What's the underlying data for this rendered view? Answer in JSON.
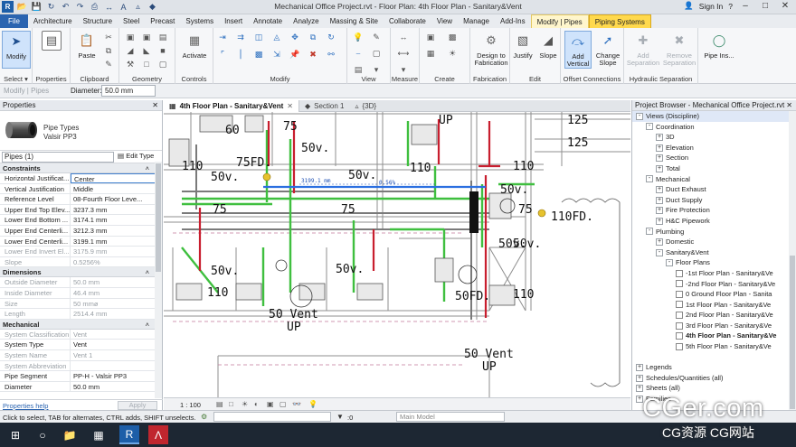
{
  "titlebar": {
    "title": "Mechanical Office Project.rvt - Floor Plan: 4th Floor Plan - Sanitary&Vent",
    "sign_in": "Sign In",
    "app_letter": "R"
  },
  "ribbon_tabs": [
    "File",
    "Architecture",
    "Structure",
    "Steel",
    "Precast",
    "Systems",
    "Insert",
    "Annotate",
    "Analyze",
    "Massing & Site",
    "Collaborate",
    "View",
    "Manage",
    "Add-Ins",
    "Modify | Pipes",
    "Piping Systems"
  ],
  "ribbon": {
    "select": {
      "modify": "Modify",
      "label": "Select ▾"
    },
    "properties": {
      "label": "Properties"
    },
    "clipboard": {
      "paste": "Paste",
      "label": "Clipboard"
    },
    "geometry": {
      "label": "Geometry"
    },
    "controls": {
      "activate": "Activate",
      "label": "Controls"
    },
    "modify": {
      "label": "Modify"
    },
    "view": {
      "label": "View"
    },
    "measure": {
      "label": "Measure"
    },
    "create": {
      "label": "Create"
    },
    "fabrication": {
      "design_to": "Design to Fabrication",
      "label": "Fabrication"
    },
    "edit": {
      "justify": "Justify",
      "slope": "Slope",
      "label": "Edit"
    },
    "offset": {
      "add_vertical": "Add Vertical",
      "change_slope": "Change Slope",
      "label": "Offset Connections"
    },
    "hydraulic": {
      "add_sep": "Add Separation",
      "remove_sep": "Remove Separation",
      "label": "Hydraulic Separation"
    },
    "pipe_ins": {
      "label": "Pipe Ins..."
    }
  },
  "optbar": {
    "context": "Modify | Pipes",
    "diameter_label": "Diameter:",
    "diameter_value": "50.0 mm"
  },
  "properties": {
    "title": "Properties",
    "type_family": "Pipe Types",
    "type_name": "Valsir PP3",
    "filter": "Pipes (1)",
    "edit_type": "Edit Type",
    "groups": [
      {
        "name": "Constraints",
        "rows": [
          {
            "k": "Horizontal Justificat...",
            "v": "Center",
            "ro": false,
            "sel": true
          },
          {
            "k": "Vertical Justification",
            "v": "Middle",
            "ro": false
          },
          {
            "k": "Reference Level",
            "v": "08-Fourth Floor Leve...",
            "ro": false
          },
          {
            "k": "Upper End Top Elev...",
            "v": "3237.3 mm",
            "ro": false
          },
          {
            "k": "Lower End Bottom ...",
            "v": "3174.1 mm",
            "ro": false
          },
          {
            "k": "Upper End Centerli...",
            "v": "3212.3 mm",
            "ro": false
          },
          {
            "k": "Lower End Centerli...",
            "v": "3199.1 mm",
            "ro": false
          },
          {
            "k": "Lower End Invert El...",
            "v": "3175.9 mm",
            "ro": true
          },
          {
            "k": "Slope",
            "v": "0.5256%",
            "ro": true
          }
        ]
      },
      {
        "name": "Dimensions",
        "rows": [
          {
            "k": "Outside Diameter",
            "v": "50.0 mm",
            "ro": true
          },
          {
            "k": "Inside Diameter",
            "v": "46.4 mm",
            "ro": true
          },
          {
            "k": "Size",
            "v": "50 mmø",
            "ro": true
          },
          {
            "k": "Length",
            "v": "2514.4 mm",
            "ro": true
          }
        ]
      },
      {
        "name": "Mechanical",
        "rows": [
          {
            "k": "System Classification",
            "v": "Vent",
            "ro": true
          },
          {
            "k": "System Type",
            "v": "Vent",
            "ro": false
          },
          {
            "k": "System Name",
            "v": "Vent 1",
            "ro": true
          },
          {
            "k": "System Abbreviation",
            "v": "",
            "ro": true
          },
          {
            "k": "Pipe Segment",
            "v": "PP-H - Valsir PP3",
            "ro": false
          },
          {
            "k": "Diameter",
            "v": "50.0 mm",
            "ro": false
          }
        ]
      }
    ],
    "help": "Properties help",
    "apply": "Apply"
  },
  "view_tabs": [
    {
      "label": "4th Floor Plan - Sanitary&Vent",
      "active": true
    },
    {
      "label": "Section 1",
      "active": false
    },
    {
      "label": "{3D}",
      "active": false
    }
  ],
  "canvas": {
    "labels": [
      "125",
      "125",
      "60",
      "75",
      "50v.",
      "50v.",
      "75FD.",
      "50v.",
      "110",
      "110",
      "50v.",
      "50v.",
      "75",
      "75",
      "110FD.",
      "50v.",
      "75",
      "50v.",
      "50v.",
      "110",
      "110",
      "50 Vent",
      "UP",
      "50FD.",
      "50 Vent",
      "UP",
      "UP",
      "110"
    ],
    "dimension": "3199.1 mm",
    "slope_tag": "0.56%"
  },
  "view_control": {
    "scale": "1 : 100"
  },
  "browser": {
    "title": "Project Browser - Mechanical Office Project.rvt",
    "items": [
      {
        "text": "Views (Discipline)",
        "lvl": 0,
        "tog": "-",
        "hl": true
      },
      {
        "text": "Coordination",
        "lvl": 1,
        "tog": "-"
      },
      {
        "text": "3D",
        "lvl": 2,
        "tog": "+"
      },
      {
        "text": "Elevation",
        "lvl": 2,
        "tog": "+"
      },
      {
        "text": "Section",
        "lvl": 2,
        "tog": "+"
      },
      {
        "text": "Total",
        "lvl": 2,
        "tog": "+"
      },
      {
        "text": "Mechanical",
        "lvl": 1,
        "tog": "-"
      },
      {
        "text": "Duct Exhaust",
        "lvl": 2,
        "tog": "+"
      },
      {
        "text": "Duct Supply",
        "lvl": 2,
        "tog": "+"
      },
      {
        "text": "Fire Protection",
        "lvl": 2,
        "tog": "+"
      },
      {
        "text": "H&C Pipework",
        "lvl": 2,
        "tog": "+"
      },
      {
        "text": "Plumbing",
        "lvl": 1,
        "tog": "-"
      },
      {
        "text": "Domestic",
        "lvl": 2,
        "tog": "+"
      },
      {
        "text": "Sanitary&Vent",
        "lvl": 2,
        "tog": "-"
      },
      {
        "text": "Floor Plans",
        "lvl": 3,
        "tog": "-"
      },
      {
        "text": "-1st Floor Plan - Sanitary&Ve",
        "lvl": 4,
        "sheet": true
      },
      {
        "text": "-2nd Floor Plan - Sanitary&Ve",
        "lvl": 4,
        "sheet": true
      },
      {
        "text": "0 Ground Floor Plan - Sanita",
        "lvl": 4,
        "sheet": true
      },
      {
        "text": "1st Floor Plan - Sanitary&Ve",
        "lvl": 4,
        "sheet": true
      },
      {
        "text": "2nd Floor Plan - Sanitary&Ve",
        "lvl": 4,
        "sheet": true
      },
      {
        "text": "3rd Floor Plan - Sanitary&Ve",
        "lvl": 4,
        "sheet": true
      },
      {
        "text": "4th Floor Plan - Sanitary&Ve",
        "lvl": 4,
        "sheet": true,
        "bold": true
      },
      {
        "text": "5th Floor Plan - Sanitary&Ve",
        "lvl": 4,
        "sheet": true
      },
      {
        "text": "",
        "lvl": 0,
        "spacer": true
      },
      {
        "text": "Legends",
        "lvl": 0,
        "tog": "+"
      },
      {
        "text": "Schedules/Quantities (all)",
        "lvl": 0,
        "tog": "+"
      },
      {
        "text": "Sheets (all)",
        "lvl": 0,
        "tog": "+"
      },
      {
        "text": "Families",
        "lvl": 0,
        "tog": "+"
      }
    ]
  },
  "status": {
    "message": "Click to select, TAB for alternates, CTRL adds, SHIFT unselects.",
    "selection_count": ":0",
    "model": "Main Model"
  },
  "watermark": {
    "big": "CGer.com",
    "small": "CG资源 CG网站"
  }
}
